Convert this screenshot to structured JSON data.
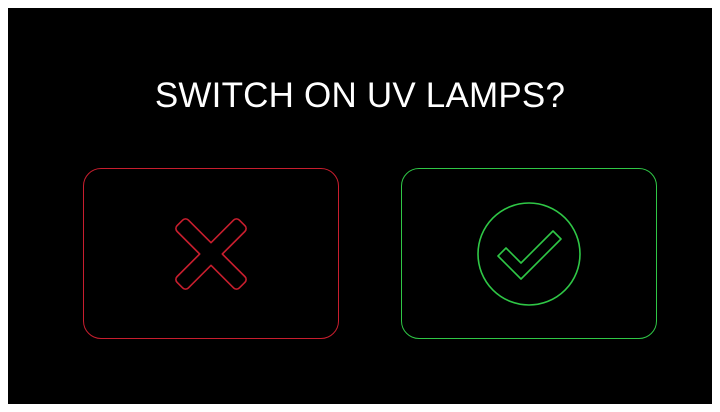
{
  "dialog": {
    "question": "SWITCH ON UV LAMPS?"
  },
  "buttons": {
    "cancel": {
      "icon": "x-icon",
      "color": "#c81e2e"
    },
    "confirm": {
      "icon": "check-circle-icon",
      "color": "#2fc746"
    }
  },
  "colors": {
    "background": "#000000",
    "text": "#ffffff"
  }
}
